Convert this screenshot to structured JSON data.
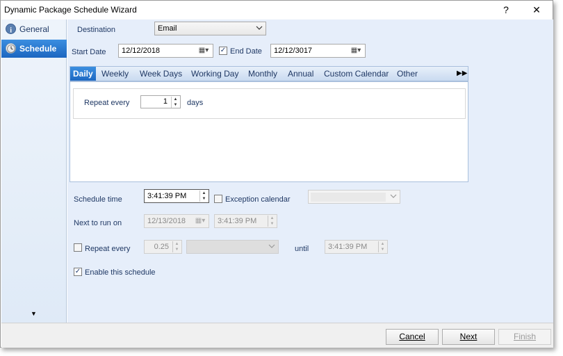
{
  "window": {
    "title": "Dynamic Package Schedule Wizard",
    "help_glyph": "?",
    "close_glyph": "✕"
  },
  "sidebar": {
    "items": [
      {
        "label": "General",
        "icon": "info-icon"
      },
      {
        "label": "Schedule",
        "icon": "clock-icon"
      }
    ],
    "more_glyph": "▼"
  },
  "form": {
    "destination_label": "Destination",
    "destination_value": "Email",
    "start_date_label": "Start Date",
    "start_date_value": "12/12/2018",
    "end_date_label": "End Date",
    "end_date_value": "12/12/3017",
    "end_date_checked": true,
    "schedule_time_label": "Schedule time",
    "schedule_time_value": "3:41:39 PM",
    "exception_calendar_label": "Exception calendar",
    "exception_calendar_checked": false,
    "next_run_label": "Next to run on",
    "next_run_date": "12/13/2018",
    "next_run_time": "3:41:39 PM",
    "repeat_every_label": "Repeat every",
    "repeat_every_checked": false,
    "repeat_every_value": "0.25",
    "until_label": "until",
    "until_value": "3:41:39 PM",
    "enable_label": "Enable this schedule",
    "enable_checked": true
  },
  "tabs": {
    "items": [
      "Daily",
      "Weekly",
      "Week Days",
      "Working Day",
      "Monthly",
      "Annual",
      "Custom Calendar",
      "Other"
    ],
    "active": "Daily",
    "scroll_glyph": "▶▶"
  },
  "daily": {
    "repeat_label": "Repeat every",
    "repeat_value": "1",
    "unit_label": "days"
  },
  "footer": {
    "cancel_label": "Cancel",
    "next_label": "Next",
    "finish_label": "Finish"
  },
  "colors": {
    "accent": "#1c66c0",
    "panel_bg": "#e6eefa",
    "text": "#1f3864"
  }
}
